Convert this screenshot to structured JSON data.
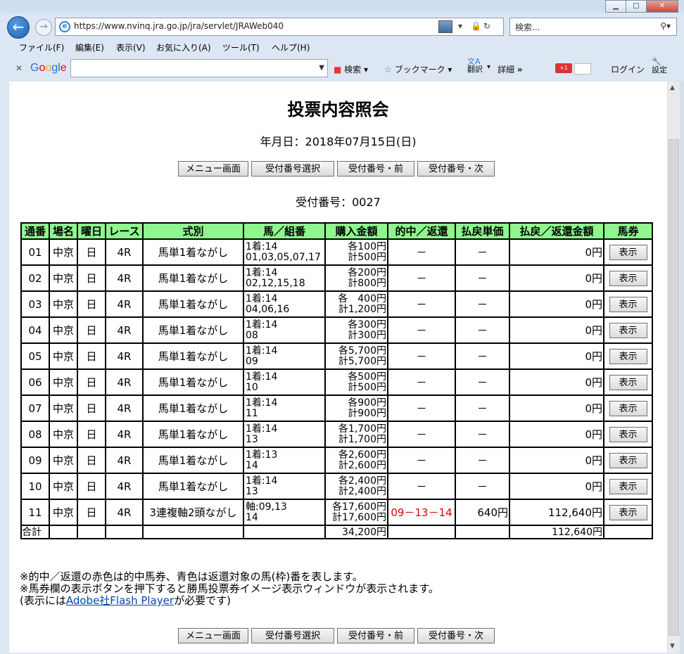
{
  "browser": {
    "url": "https://www.nvinq.jra.go.jp/jra/servlet/JRAWeb040",
    "search_placeholder": "検索...",
    "menu": [
      "ファイル(F)",
      "編集(E)",
      "表示(V)",
      "お気に入り(A)",
      "ツール(T)",
      "ヘルプ(H)"
    ],
    "google": {
      "logo": "Google",
      "search_label": "検索",
      "bookmark_label": "ブックマーク",
      "translate_label": "翻訳",
      "details_label": "詳細",
      "gplus_label": "+1",
      "login_label": "ログイン",
      "settings_label": "設定"
    }
  },
  "page": {
    "title": "投票内容照会",
    "date": "年月日：2018年07月15日(日)",
    "buttons": {
      "menu": "メニュー画面",
      "select": "受付番号選択",
      "prev": "受付番号・前",
      "next": "受付番号・次"
    },
    "receipt": "受付番号：0027",
    "headers": [
      "通番",
      "場名",
      "曜日",
      "レース",
      "式別",
      "馬／組番",
      "購入金額",
      "的中／返還",
      "払戻単価",
      "払戻／返還金額",
      "馬券"
    ],
    "show_label": "表示",
    "rows": [
      {
        "no": "01",
        "place": "中京",
        "day": "日",
        "race": "4R",
        "type": "馬単1着ながし",
        "combo1": "1着:14",
        "combo2": "01,03,05,07,17",
        "amt1": "各100円",
        "amt2": "計500円",
        "hit": "－",
        "unit": "－",
        "payout": "0円"
      },
      {
        "no": "02",
        "place": "中京",
        "day": "日",
        "race": "4R",
        "type": "馬単1着ながし",
        "combo1": "1着:14",
        "combo2": "02,12,15,18",
        "amt1": "各200円",
        "amt2": "計800円",
        "hit": "－",
        "unit": "－",
        "payout": "0円"
      },
      {
        "no": "03",
        "place": "中京",
        "day": "日",
        "race": "4R",
        "type": "馬単1着ながし",
        "combo1": "1着:14",
        "combo2": "04,06,16",
        "amt1": "各　400円",
        "amt2": "計1,200円",
        "hit": "－",
        "unit": "－",
        "payout": "0円"
      },
      {
        "no": "04",
        "place": "中京",
        "day": "日",
        "race": "4R",
        "type": "馬単1着ながし",
        "combo1": "1着:14",
        "combo2": "08",
        "amt1": "各300円",
        "amt2": "計300円",
        "hit": "－",
        "unit": "－",
        "payout": "0円"
      },
      {
        "no": "05",
        "place": "中京",
        "day": "日",
        "race": "4R",
        "type": "馬単1着ながし",
        "combo1": "1着:14",
        "combo2": "09",
        "amt1": "各5,700円",
        "amt2": "計5,700円",
        "hit": "－",
        "unit": "－",
        "payout": "0円"
      },
      {
        "no": "06",
        "place": "中京",
        "day": "日",
        "race": "4R",
        "type": "馬単1着ながし",
        "combo1": "1着:14",
        "combo2": "10",
        "amt1": "各500円",
        "amt2": "計500円",
        "hit": "－",
        "unit": "－",
        "payout": "0円"
      },
      {
        "no": "07",
        "place": "中京",
        "day": "日",
        "race": "4R",
        "type": "馬単1着ながし",
        "combo1": "1着:14",
        "combo2": "11",
        "amt1": "各900円",
        "amt2": "計900円",
        "hit": "－",
        "unit": "－",
        "payout": "0円"
      },
      {
        "no": "08",
        "place": "中京",
        "day": "日",
        "race": "4R",
        "type": "馬単1着ながし",
        "combo1": "1着:14",
        "combo2": "13",
        "amt1": "各1,700円",
        "amt2": "計1,700円",
        "hit": "－",
        "unit": "－",
        "payout": "0円"
      },
      {
        "no": "09",
        "place": "中京",
        "day": "日",
        "race": "4R",
        "type": "馬単1着ながし",
        "combo1": "1着:13",
        "combo2": "14",
        "amt1": "各2,600円",
        "amt2": "計2,600円",
        "hit": "－",
        "unit": "－",
        "payout": "0円"
      },
      {
        "no": "10",
        "place": "中京",
        "day": "日",
        "race": "4R",
        "type": "馬単1着ながし",
        "combo1": "1着:14",
        "combo2": "13",
        "amt1": "各2,400円",
        "amt2": "計2,400円",
        "hit": "－",
        "unit": "－",
        "payout": "0円"
      },
      {
        "no": "11",
        "place": "中京",
        "day": "日",
        "race": "4R",
        "type": "3連複軸2頭ながし",
        "combo1": "軸:09,13",
        "combo2": "14",
        "amt1": "各17,600円",
        "amt2": "計17,600円",
        "hit": "09－13－14",
        "unit": "640円",
        "payout": "112,640円"
      }
    ],
    "total": {
      "label": "合計",
      "amount": "34,200円",
      "payout": "112,640円"
    },
    "notes": {
      "line1": "※的中／返還の赤色は的中馬券、青色は返還対象の馬(枠)番を表します。",
      "line2": "※馬券欄の表示ボタンを押下すると勝馬投票券イメージ表示ウィンドウが表示されます。",
      "line3_pre": "(表示には",
      "line3_link": "Adobe社Flash Player",
      "line3_post": "が必要です)"
    }
  }
}
